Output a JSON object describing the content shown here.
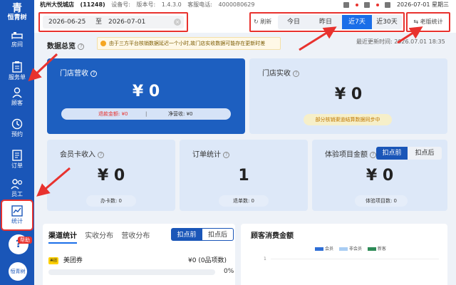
{
  "sidebar": {
    "brand_mark": "青",
    "brand_name": "恒青树",
    "items": [
      {
        "label": "房间"
      },
      {
        "label": "服务单"
      },
      {
        "label": "顾客"
      },
      {
        "label": "预约"
      },
      {
        "label": "订单"
      },
      {
        "label": "员工"
      },
      {
        "label": "统计"
      }
    ],
    "help_tag": "帮助",
    "avatar_label": "恒青树"
  },
  "status_bar": {
    "store_name": "杭州大悦城店",
    "store_id": "(11248)",
    "device_label": "设备号:",
    "version_label": "版本号:",
    "version": "1.4.3.0",
    "hotline_label": "客服电话:",
    "hotline": "4000080629",
    "datetime": "2026-07-01 星期三"
  },
  "toolbar": {
    "date_start": "2026-06-25",
    "date_sep": "至",
    "date_end": "2026-07-01",
    "refresh_label": "刷新",
    "ranges": [
      "今日",
      "昨日",
      "近7天",
      "近30天"
    ],
    "active_range": "近7天",
    "legacy_label": "老版统计"
  },
  "overview": {
    "title": "数据总览",
    "notice": "由于三方平台核销数据延迟一个小时,故门店实收数据可能存在更新时差",
    "updated_label": "最近更新时间:",
    "updated_time": "2026.07.01 18:35"
  },
  "cards": {
    "store_revenue": {
      "title": "门店营收",
      "value": "¥ 0",
      "refund_label": "退款金额:",
      "refund_value": "¥0",
      "divider": "|",
      "net_label": "净营收:",
      "net_value": "¥0"
    },
    "store_actual": {
      "title": "门店实收",
      "value": "¥ 0",
      "pill": "部分核销渠道结算数据同步中"
    },
    "member_card": {
      "title": "会员卡收入",
      "value": "¥ 0",
      "pill": "办卡数: 0"
    },
    "orders": {
      "title": "订单统计",
      "value": "1",
      "pill": "退单数: 0"
    },
    "experience": {
      "title": "体验项目金额",
      "toggle_before": "扣点前",
      "toggle_after": "扣点后",
      "value": "¥ 0",
      "pill": "体验项目数: 0"
    }
  },
  "channel": {
    "tabs": [
      "渠道统计",
      "实收分布",
      "营收分布"
    ],
    "toggle_before": "扣点前",
    "toggle_after": "扣点后",
    "rows": [
      {
        "logo": "美团",
        "name": "美团券",
        "value": "¥0 (0品项数)",
        "percent": "0%",
        "progress": 0
      }
    ]
  },
  "consumption": {
    "title": "顾客消费金额",
    "legend": [
      {
        "name": "会员",
        "color": "#2f6fd6"
      },
      {
        "name": "非会员",
        "color": "#a9cdf3"
      },
      {
        "name": "新客",
        "color": "#2e8b57"
      }
    ],
    "y_tick": "1"
  },
  "colors": {
    "sidebar": "#1a56b8",
    "accent": "#1a6ee8",
    "highlight_red": "#e8322e",
    "card_blue": "#1d5fc0",
    "card_light": "#dde8f8"
  }
}
